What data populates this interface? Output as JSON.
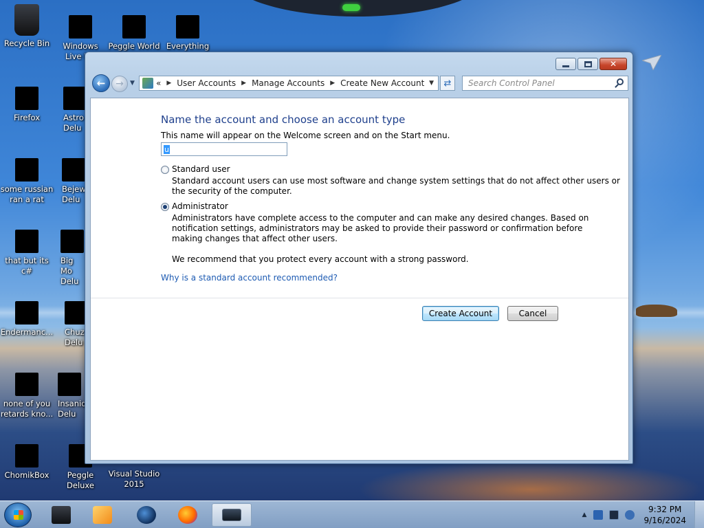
{
  "desktop": {
    "icons": [
      {
        "label": "Recycle Bin"
      },
      {
        "label": "Windows Live Ma"
      },
      {
        "label": "Peggle World"
      },
      {
        "label": "Everything"
      },
      {
        "label": "Firefox"
      },
      {
        "label": "Astro Delu"
      },
      {
        "label": "some russian ran a rat"
      },
      {
        "label": "Bejew Delu"
      },
      {
        "label": "that but its c#"
      },
      {
        "label": "Big Mo Delu"
      },
      {
        "label": "Endermanc..."
      },
      {
        "label": "Chuz Delu"
      },
      {
        "label": "none of you retards kno..."
      },
      {
        "label": "Insaniq Delu"
      },
      {
        "label": "ChomikBox"
      },
      {
        "label": "Peggle Deluxe"
      },
      {
        "label": "Visual Studio 2015"
      }
    ]
  },
  "window": {
    "breadcrumb": [
      "User Accounts",
      "Manage Accounts",
      "Create New Account"
    ],
    "breadcrumb_prefix": "«",
    "search_placeholder": "Search Control Panel",
    "controls": {
      "close": "✕"
    }
  },
  "page": {
    "heading": "Name the account and choose an account type",
    "subtext": "This name will appear on the Welcome screen and on the Start menu.",
    "name_value": "u",
    "options": [
      {
        "label": "Standard user",
        "checked": false,
        "desc": [
          "Standard account users can use most software and change system settings that do not affect other users or",
          "the security of the computer."
        ]
      },
      {
        "label": "Administrator",
        "checked": true,
        "desc": [
          "Administrators have complete access to the computer and can make any desired changes. Based on",
          "notification settings, administrators may be asked to provide their password or confirmation before",
          "making changes that affect other users."
        ]
      }
    ],
    "recommendation": "We recommend that you protect every account with a strong password.",
    "help_link": "Why is a standard account recommended?",
    "create_button": "Create Account",
    "cancel_button": "Cancel"
  },
  "taskbar": {
    "time": "9:32 PM",
    "date": "9/16/2024"
  },
  "colors": {
    "heading": "#1e3f8c",
    "link": "#1c5ab2",
    "default_button": "#bee6fd"
  }
}
